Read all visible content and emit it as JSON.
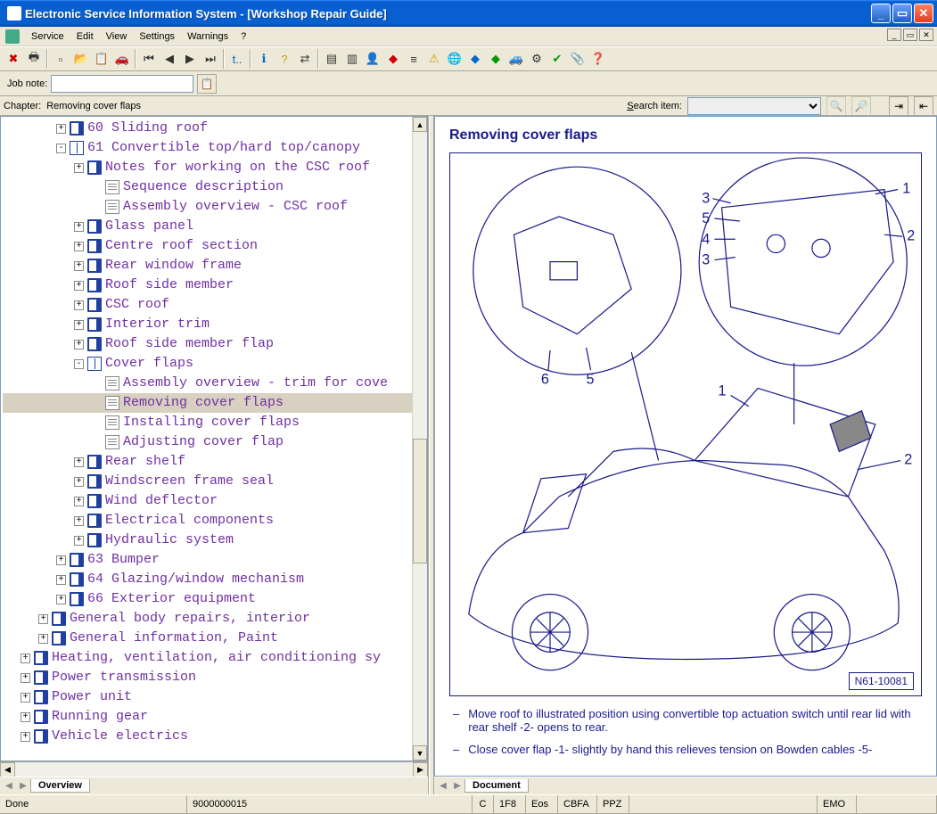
{
  "window": {
    "title": "Electronic Service Information System - [Workshop Repair Guide]"
  },
  "menu": {
    "items": [
      "Service",
      "Edit",
      "View",
      "Settings",
      "Warnings",
      "?"
    ]
  },
  "jobnote": {
    "label": "Job note:"
  },
  "header": {
    "chapter_label": "Chapter:",
    "chapter_text": "Removing cover flaps",
    "search_label": "Search item:"
  },
  "tree": [
    {
      "depth": 3,
      "toggle": "+",
      "icon": "book",
      "label": "60 Sliding roof"
    },
    {
      "depth": 3,
      "toggle": "-",
      "icon": "bookopen",
      "label": "61 Convertible top/hard top/canopy"
    },
    {
      "depth": 4,
      "toggle": "+",
      "icon": "book",
      "label": "Notes for working on the CSC roof"
    },
    {
      "depth": 5,
      "toggle": "",
      "icon": "doc",
      "label": "Sequence description"
    },
    {
      "depth": 5,
      "toggle": "",
      "icon": "doc",
      "label": "Assembly overview - CSC roof"
    },
    {
      "depth": 4,
      "toggle": "+",
      "icon": "book",
      "label": "Glass panel"
    },
    {
      "depth": 4,
      "toggle": "+",
      "icon": "book",
      "label": "Centre roof section"
    },
    {
      "depth": 4,
      "toggle": "+",
      "icon": "book",
      "label": "Rear window frame"
    },
    {
      "depth": 4,
      "toggle": "+",
      "icon": "book",
      "label": "Roof side member"
    },
    {
      "depth": 4,
      "toggle": "+",
      "icon": "book",
      "label": "CSC roof"
    },
    {
      "depth": 4,
      "toggle": "+",
      "icon": "book",
      "label": "Interior trim"
    },
    {
      "depth": 4,
      "toggle": "+",
      "icon": "book",
      "label": "Roof side member flap"
    },
    {
      "depth": 4,
      "toggle": "-",
      "icon": "bookopen",
      "label": "Cover flaps"
    },
    {
      "depth": 5,
      "toggle": "",
      "icon": "doc",
      "label": "Assembly overview - trim for cove"
    },
    {
      "depth": 5,
      "toggle": "",
      "icon": "doc",
      "label": "Removing cover flaps",
      "selected": true
    },
    {
      "depth": 5,
      "toggle": "",
      "icon": "doc",
      "label": "Installing cover flaps"
    },
    {
      "depth": 5,
      "toggle": "",
      "icon": "doc",
      "label": "Adjusting cover flap"
    },
    {
      "depth": 4,
      "toggle": "+",
      "icon": "book",
      "label": "Rear shelf"
    },
    {
      "depth": 4,
      "toggle": "+",
      "icon": "book",
      "label": "Windscreen frame seal"
    },
    {
      "depth": 4,
      "toggle": "+",
      "icon": "book",
      "label": "Wind deflector"
    },
    {
      "depth": 4,
      "toggle": "+",
      "icon": "book",
      "label": "Electrical components"
    },
    {
      "depth": 4,
      "toggle": "+",
      "icon": "book",
      "label": "Hydraulic system"
    },
    {
      "depth": 3,
      "toggle": "+",
      "icon": "book",
      "label": "63 Bumper"
    },
    {
      "depth": 3,
      "toggle": "+",
      "icon": "book",
      "label": "64 Glazing/window mechanism"
    },
    {
      "depth": 3,
      "toggle": "+",
      "icon": "book",
      "label": "66 Exterior equipment"
    },
    {
      "depth": 2,
      "toggle": "+",
      "icon": "book",
      "label": "General body repairs, interior"
    },
    {
      "depth": 2,
      "toggle": "+",
      "icon": "book",
      "label": "General information, Paint"
    },
    {
      "depth": 1,
      "toggle": "+",
      "icon": "book",
      "label": "Heating, ventilation, air conditioning sy"
    },
    {
      "depth": 1,
      "toggle": "+",
      "icon": "book",
      "label": "Power transmission"
    },
    {
      "depth": 1,
      "toggle": "+",
      "icon": "book",
      "label": "Power unit"
    },
    {
      "depth": 1,
      "toggle": "+",
      "icon": "book",
      "label": "Running gear"
    },
    {
      "depth": 1,
      "toggle": "+",
      "icon": "book",
      "label": "Vehicle electrics"
    }
  ],
  "tabs": {
    "left": "Overview",
    "right": "Document"
  },
  "content": {
    "heading": "Removing cover flaps",
    "figure_id": "N61-10081",
    "callouts": [
      "1",
      "2",
      "3",
      "4",
      "5",
      "6",
      "1",
      "2",
      "3",
      "5"
    ],
    "paragraphs": [
      "Move roof to illustrated position using convertible top actuation switch until rear lid with rear shelf -2- opens to rear.",
      "Close cover flap -1- slightly by hand this relieves tension on Bowden cables -5-"
    ]
  },
  "status": {
    "left": "Done",
    "code": "9000000015",
    "c": "C",
    "f": "1F8",
    "eos": "Eos",
    "cbfa": "CBFA",
    "ppz": "PPZ",
    "emo": "EMO"
  },
  "toolbar_icons": [
    "stop-icon",
    "print-icon",
    "sep",
    "new-icon",
    "open-icon",
    "copy-icon",
    "car-icon",
    "sep",
    "first-icon",
    "prev-icon",
    "next-icon",
    "last-icon",
    "sep",
    "tool-icon",
    "sep",
    "info-icon",
    "help-icon",
    "swap-icon",
    "sep",
    "doc1-icon",
    "doc2-icon",
    "person-icon",
    "bookred-icon",
    "list-icon",
    "warn-icon",
    "globe-icon",
    "bookblue-icon",
    "bookgreen-icon",
    "car2-icon",
    "gear-icon",
    "check-icon",
    "clip-icon",
    "helpdoc-icon"
  ]
}
